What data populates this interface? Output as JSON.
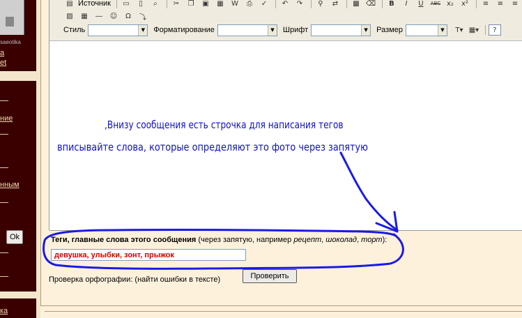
{
  "sidebar": {
    "links": [
      "а",
      "et",
      "ние",
      "нным",
      "ка"
    ],
    "thumb_caption": "saeotika",
    "ok_label": "Ok"
  },
  "toolbar": {
    "source_label": "Источник",
    "style_label": "Стиль",
    "format_label": "Форматирование",
    "font_label": "Шрифт",
    "size_label": "Размер",
    "style_value": "",
    "format_value": "",
    "font_value": "",
    "size_value": "",
    "bold": "B",
    "italic": "I",
    "underline": "U",
    "strike": "ABC",
    "help": "?"
  },
  "annotation": {
    "line1": ",Внизу сообщения есть строчка для написания тегов",
    "line2": "вписывайте слова, которые определяют это фото через запятую",
    "color": "#1010d0"
  },
  "tags": {
    "label_bold": "Теги, главные слова этого сообщения",
    "label_rest_1": " (через запятую, например ",
    "example_1": "рецепт",
    "sep_1": ", ",
    "example_2": "шоколад",
    "sep_2": ", ",
    "example_3": "торт",
    "label_end": "):",
    "value": "девушка, улыбки, зонт, прыжок",
    "value_color": "#d00000"
  },
  "spellcheck": {
    "label": "Проверка орфографии: (найти ошибки в тексте)",
    "button": "Проверить"
  }
}
